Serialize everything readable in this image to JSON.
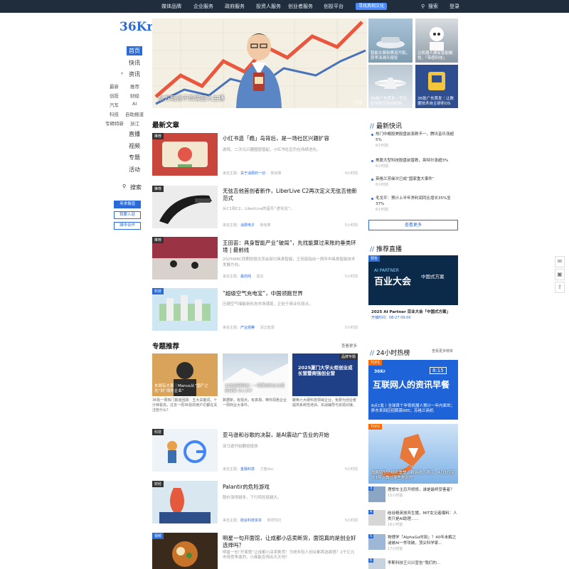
{
  "topbar": {
    "nav": [
      "媒体品牌",
      "企业服务",
      "政府服务",
      "投资人服务",
      "创业者服务",
      "创投平台"
    ],
    "promo": "寻找真相文化",
    "search": "搜索",
    "login": "登录"
  },
  "logo": "36Kr",
  "sidebar": {
    "main": [
      "首页",
      "快讯",
      "资讯"
    ],
    "sub": [
      "最新",
      "推荐",
      "创投",
      "财经",
      "汽车",
      "AI",
      "科技",
      "自助报道",
      "专精特新",
      "浙江"
    ],
    "main2": [
      "直播",
      "视频",
      "专题",
      "活动"
    ],
    "search": "搜索",
    "buttons": [
      "寻求报道",
      "我要入驻",
      "城市合作"
    ]
  },
  "hero": {
    "caption": "东方甄选不再需要大主播",
    "watermark": "36氪"
  },
  "thumbs": [
    {
      "caption": "智能水翼新赛道开跑，获李泽湘天使轮"
    },
    {
      "caption": "让机器人拥有智能触觉，「带感科技」"
    },
    {
      "caption": "36氪广东首发｜号召民用航空发动机商"
    },
    {
      "caption": "36氪广东首发｜让数据技术自主研析OS"
    }
  ],
  "latest": {
    "title": "最新文章",
    "articles": [
      {
        "tag": "推荐",
        "title": "小红书造「瘾」岛背后，是一场社区兴趣扩容",
        "desc": "游戏、二次元兴趣圈层暨起，小红书社区仍在持续进化。",
        "meta": "来自主题：",
        "topic": "关于消费的一切",
        "author": "新熔革",
        "time": "4小时前"
      },
      {
        "tag": "推荐",
        "title": "无弦吉他首创者新作，LiberLive C2再次定义无弦吉他新范式",
        "desc": "从C1到C2，LiberLive的音乐“进化论”。",
        "meta": "来自主题：",
        "topic": "消费电子",
        "author": "新熔革",
        "time": "5小时前"
      },
      {
        "tag": "推荐",
        "title": "王田苗：具身智能产业“破局”，先找能算过来账的垂类环境 | 最前线",
        "desc": "2025WRC同期创投交流会探讨具身智能，王田苗指出一两年中具身智能技术发展方向。",
        "meta": "来自主题：",
        "topic": "最前线",
        "author": "蓝先",
        "time": "5小时前"
      },
      {
        "tag": "科技",
        "title": "“超级空气充电宝”，中国领跑世界",
        "desc": "压缩空气储能新形态市场涌现，正处于商业化拐点。",
        "meta": "来自主题：",
        "topic": "产业观察",
        "author": "深正能源",
        "time": "5小时前"
      }
    ]
  },
  "topics": {
    "title": "专题推荐",
    "more": "查看更多",
    "cards": [
      {
        "caption": "本周有大事｜Manus从“国产之光”到“海外企业”",
        "desc": "36氪一周热门报道回顾：五大关键词，十分钟看完，过去一周36氪的用户们都在关注些什么？"
      },
      {
        "caption": "36氪编辑精选｜一周要读的企业报道合集 Vol.247",
        "desc": "数据新，有观点，有真相，带你洞悉企业一周商业大事件。"
      },
      {
        "badge": "品牌专题",
        "caption": "2025厦门大学火炬创业成长营暨商强创业营",
        "desc": "聚焦六大硬科技领域企业，免费为创业者提供系统性培训、实战辅导与资源对接。"
      }
    ]
  },
  "more_articles": [
    {
      "tag": "科技",
      "title": "亚马逊和谷歌的决裂，是AI震动广告业的开始",
      "desc": "亚马逊开始翻倍投放",
      "meta": "来自主题：",
      "topic": "金融科技",
      "author": "刀客doc",
      "time": "5小时前"
    },
    {
      "tag": "财经",
      "title": "Palantir的危险游戏",
      "desc": "股价涨得越多，下行风险就越大。",
      "meta": "来自主题：",
      "topic": "硅谷科技资本",
      "author": "新研究社",
      "time": "5小时前"
    },
    {
      "tag": "视频",
      "title": "明星一句开面馆，让成都小店卖断货，面馆真的是创业好选择吗？",
      "desc": "明星一句“开面馆”让成都小店卖断货！为啥年轻人创业都首选面馆？2千亿元市场竞争激烈，小面能否闯出大天地？",
      "meta": "",
      "topic": "",
      "author": "",
      "time": ""
    }
  ],
  "flash": {
    "title": "最新快讯",
    "items": [
      {
        "text": "热门中概股美股盘前涨跌不一，腾讯音乐涨超5%",
        "time": "6小时前"
      },
      {
        "text": "美股大型科技股盘前普跌，英特尔涨超3%",
        "time": "6小时前"
      },
      {
        "text": "英格兰芳缘次已成“国家重大事件”",
        "time": "6小时前"
      },
      {
        "text": "毛戈平：预计上半年净利润同比增长35%至37%",
        "time": "6小时前"
      }
    ],
    "more": "查看更多"
  },
  "live": {
    "title": "推荐直播",
    "badge": "预告",
    "banner1": "AI PARTNER",
    "banner2": "百业大会",
    "banner3": "中国式方案",
    "name": "2025 AI Partner 百业大会「中国式方案」",
    "time": "开播时间：08-27 09:00"
  },
  "hot": {
    "title": "24小时热榜",
    "more": "查看更多榜单",
    "top1_badge": "TOP1",
    "top1_label": "36Kr",
    "top1_time": "8:15",
    "top1_banner": "互联网人的资讯早餐",
    "top1_caption": "8点1氪丨全球首个孕育机器人预计一年内面世；胖东来回应招聘需985；苏格兰商机",
    "top2_badge": "TOP2",
    "top2_caption": "战略转型、组织重塑、精简收入项目，4月1日至今1年，做过那些是对的",
    "items": [
      {
        "rank": "3",
        "text": "理想车主忍开修修，谁是最终受害者？",
        "time": "15小时前"
      },
      {
        "rank": "4",
        "text": "硅谷精英放弃生猪，MIT女记者爆料：人类只是AI助理……",
        "time": "16小时前"
      },
      {
        "rank": "5",
        "text": "物理学「AlphaGo时刻」？40年未解之谜被AI一举攻破，顶尖科学家...",
        "time": "17小时前"
      },
      {
        "rank": "6",
        "text": "李斯科技王兴兴宣告“我们的...",
        "time": ""
      }
    ]
  },
  "colors": {
    "accent": "#2a6ad9",
    "topbar": "#1f2d3d",
    "hot_badge": "#ff6a00"
  }
}
